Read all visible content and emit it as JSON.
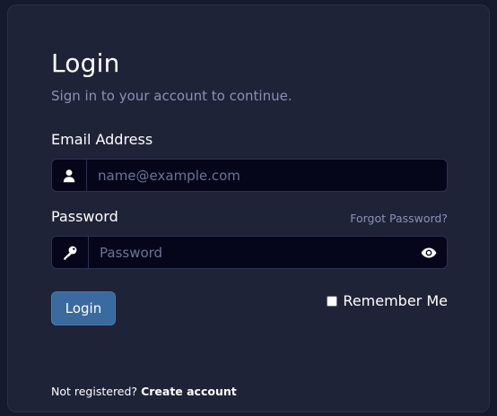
{
  "login": {
    "title": "Login",
    "subtitle": "Sign in to your account to continue.",
    "email_label": "Email Address",
    "email_placeholder": "name@example.com",
    "password_label": "Password",
    "forgot_password": "Forgot Password?",
    "password_placeholder": "Password",
    "login_button": "Login",
    "remember_me": "Remember Me",
    "remember_checked": false,
    "not_registered": "Not registered?",
    "create_account": "Create account"
  },
  "icons": {
    "email_addon": "user-icon",
    "password_addon": "key-icon",
    "password_toggle": "eye-icon"
  },
  "colors": {
    "page_bg": "#161a2e",
    "card_bg": "#1f2338",
    "input_bg": "#05061a",
    "primary_button": "#3a6a9e",
    "muted_text": "#8a91b4"
  }
}
